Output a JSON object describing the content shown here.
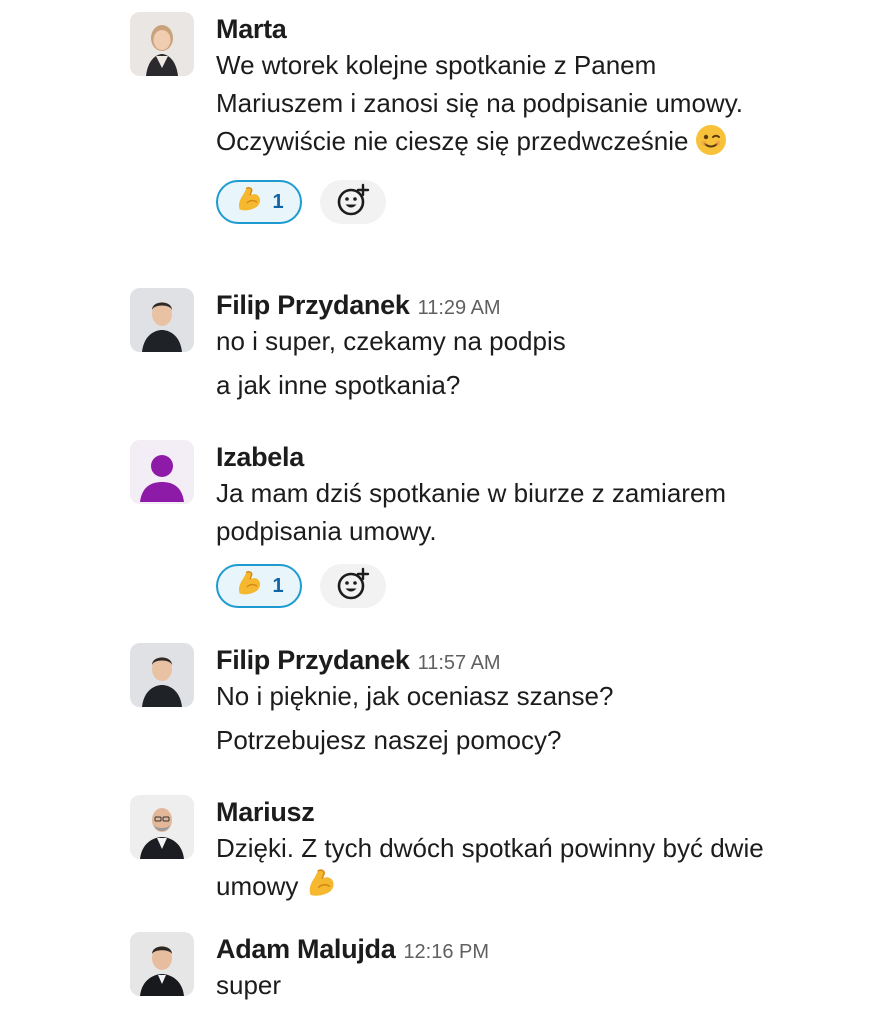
{
  "messages": [
    {
      "author": "Marta",
      "time": "",
      "lines": [
        "We wtorek kolejne spotkanie z Panem Mariuszem i zanosi się na podpisanie umowy. Oczywiście nie cieszę się przedwcześnie"
      ],
      "inline_emoji": "winking-face",
      "reaction": {
        "emoji": "flexed-biceps",
        "count": "1"
      }
    },
    {
      "author": "Filip Przydanek",
      "time": "11:29 AM",
      "lines": [
        "no i super, czekamy na podpis",
        "a jak inne spotkania?"
      ]
    },
    {
      "author": "Izabela",
      "time": "",
      "lines": [
        "Ja mam dziś spotkanie w biurze z zamiarem podpisania umowy."
      ],
      "reaction": {
        "emoji": "flexed-biceps",
        "count": "1"
      }
    },
    {
      "author": "Filip Przydanek",
      "time": "11:57 AM",
      "lines": [
        "No i pięknie, jak oceniasz szanse?",
        "Potrzebujesz naszej pomocy?"
      ]
    },
    {
      "author": "Mariusz",
      "time": "",
      "lines": [
        "Dzięki. Z tych dwóch spotkań powinny być dwie umowy"
      ],
      "inline_emoji": "flexed-biceps"
    },
    {
      "author": "Adam Malujda",
      "time": "12:16 PM",
      "lines": [
        "super"
      ]
    }
  ],
  "colors": {
    "reaction_border": "#1d9bd1",
    "reaction_bg": "#e8f5fa",
    "reaction_count": "#1264a3",
    "timestamp": "#616061",
    "default_avatar": "#8e1aa8"
  }
}
